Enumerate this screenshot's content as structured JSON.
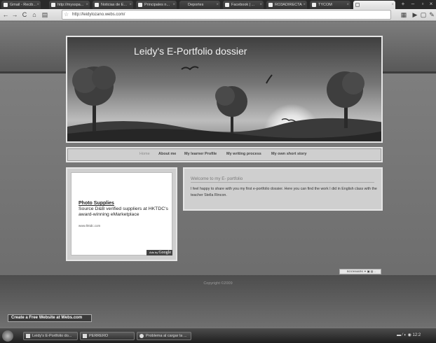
{
  "browser": {
    "tabs": [
      {
        "label": "Gmail - Recib..."
      },
      {
        "label": "http://mysspa..."
      },
      {
        "label": "Noticias de E..."
      },
      {
        "label": "Principales n..."
      },
      {
        "label": "Deportes"
      },
      {
        "label": "Facebook | ..."
      },
      {
        "label": "RO3ADIRECTA"
      },
      {
        "label": "TYCOM"
      },
      {
        "label": ""
      }
    ],
    "url": "http://leidylozano.webs.com/"
  },
  "site": {
    "title": "Leidy's E-Portfolio dossier",
    "nav": [
      "Home",
      "About me",
      "My learner Profile",
      "My writing process",
      "My own short story"
    ],
    "ad": {
      "link": "Photo Supplies",
      "text": "Source D&B verified suppliers at HKTDC's award-winning eMarketplace",
      "url": "www.hktdc.com",
      "ads_by": "Ads by",
      "google": "Google"
    },
    "content": {
      "heading": "Welcome to my E- portfolio",
      "body": "I feel happy to share with you my first e-portfolio dossier.  Here you can find the work I did in English class with the teacher Stella Rincon."
    },
    "bookmark": "BOOKMARK",
    "copyright": "Copyright ©2009",
    "webs_button": "Create a Free Website at Webs.com"
  },
  "taskbar": {
    "items": [
      {
        "label": "Leidy's E-Portfolio do..."
      },
      {
        "label": "PERRERO"
      },
      {
        "label": "Problema al cargar la ..."
      }
    ],
    "clock": "12:2"
  },
  "colors": {
    "page_bg": "#7a7a7a",
    "banner_border": "#e6e6e6"
  }
}
